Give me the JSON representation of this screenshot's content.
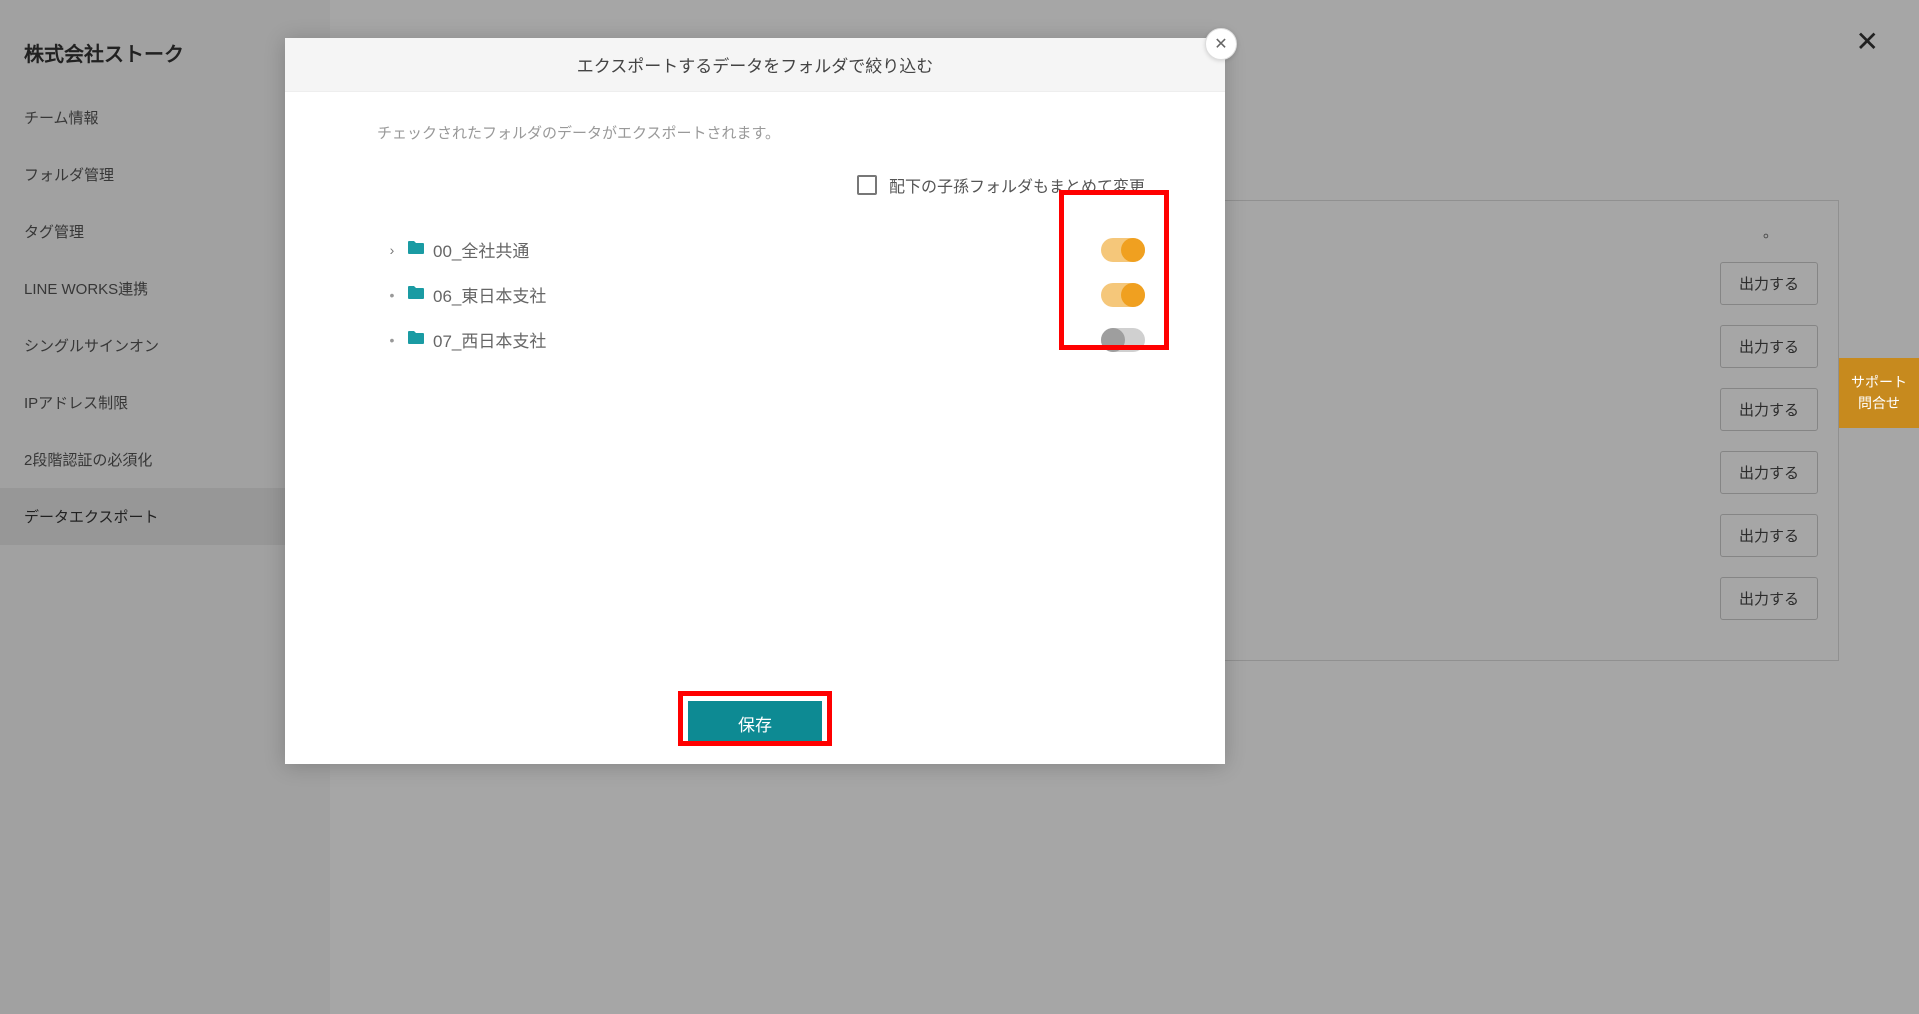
{
  "sidebar": {
    "title": "株式会社ストーク",
    "items": [
      {
        "label": "チーム情報"
      },
      {
        "label": "フォルダ管理"
      },
      {
        "label": "タグ管理"
      },
      {
        "label": "LINE WORKS連携"
      },
      {
        "label": "シングルサインオン"
      },
      {
        "label": "IPアドレス制限"
      },
      {
        "label": "2段階認証の必須化"
      },
      {
        "label": "データエクスポート"
      }
    ],
    "active_index": 7
  },
  "main": {
    "card_suffix": "。",
    "export_label": "出力する"
  },
  "support": {
    "line1": "サポート",
    "line2": "問合せ"
  },
  "modal": {
    "title": "エクスポートするデータをフォルダで絞り込む",
    "description": "チェックされたフォルダのデータがエクスポートされます。",
    "checkbox_label": "配下の子孫フォルダもまとめて変更",
    "folders": [
      {
        "name": "00_全社共通",
        "expandable": true,
        "enabled": true
      },
      {
        "name": "06_東日本支社",
        "expandable": false,
        "enabled": true
      },
      {
        "name": "07_西日本支社",
        "expandable": false,
        "enabled": false
      }
    ],
    "save_label": "保存"
  }
}
